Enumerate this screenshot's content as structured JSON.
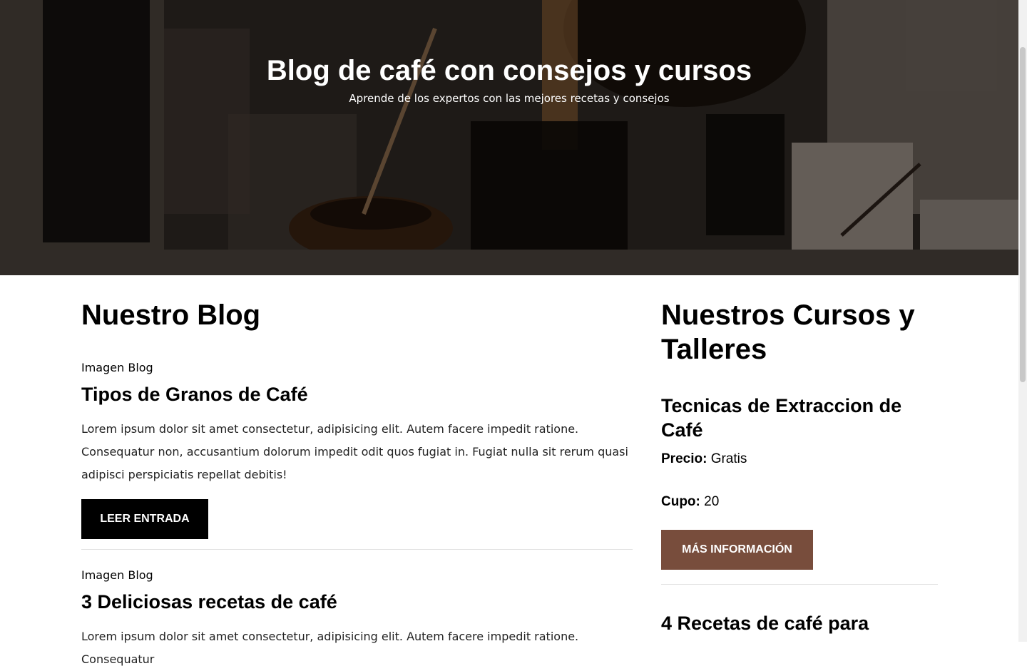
{
  "hero": {
    "title": "Blog de café con consejos y cursos",
    "subtitle": "Aprende de los expertos con las mejores recetas y consejos"
  },
  "blog": {
    "title": "Nuestro Blog",
    "entries": [
      {
        "image_alt": "Imagen Blog",
        "title": "Tipos de Granos de Café",
        "text": "Lorem ipsum dolor sit amet consectetur, adipisicing elit. Autem facere impedit ratione. Consequatur non, accusantium dolorum impedit odit quos fugiat in. Fugiat nulla sit rerum quasi adipisci perspiciatis repellat debitis!",
        "button": "LEER ENTRADA"
      },
      {
        "image_alt": "Imagen Blog",
        "title": "3 Deliciosas recetas de café",
        "text": "Lorem ipsum dolor sit amet consectetur, adipisicing elit. Autem facere impedit ratione. Consequatur"
      }
    ]
  },
  "courses": {
    "title": "Nuestros Cursos y Talleres",
    "items": [
      {
        "title": "Tecnicas de Extraccion de Café",
        "price_label": "Precio:",
        "price_value": "Gratis",
        "quota_label": "Cupo:",
        "quota_value": "20",
        "button": "MÁS INFORMACIÓN"
      },
      {
        "title": "4 Recetas de café para"
      }
    ]
  },
  "colors": {
    "button_dark": "#000000",
    "button_brown": "#784d3c",
    "divider": "#e2e2e2"
  }
}
